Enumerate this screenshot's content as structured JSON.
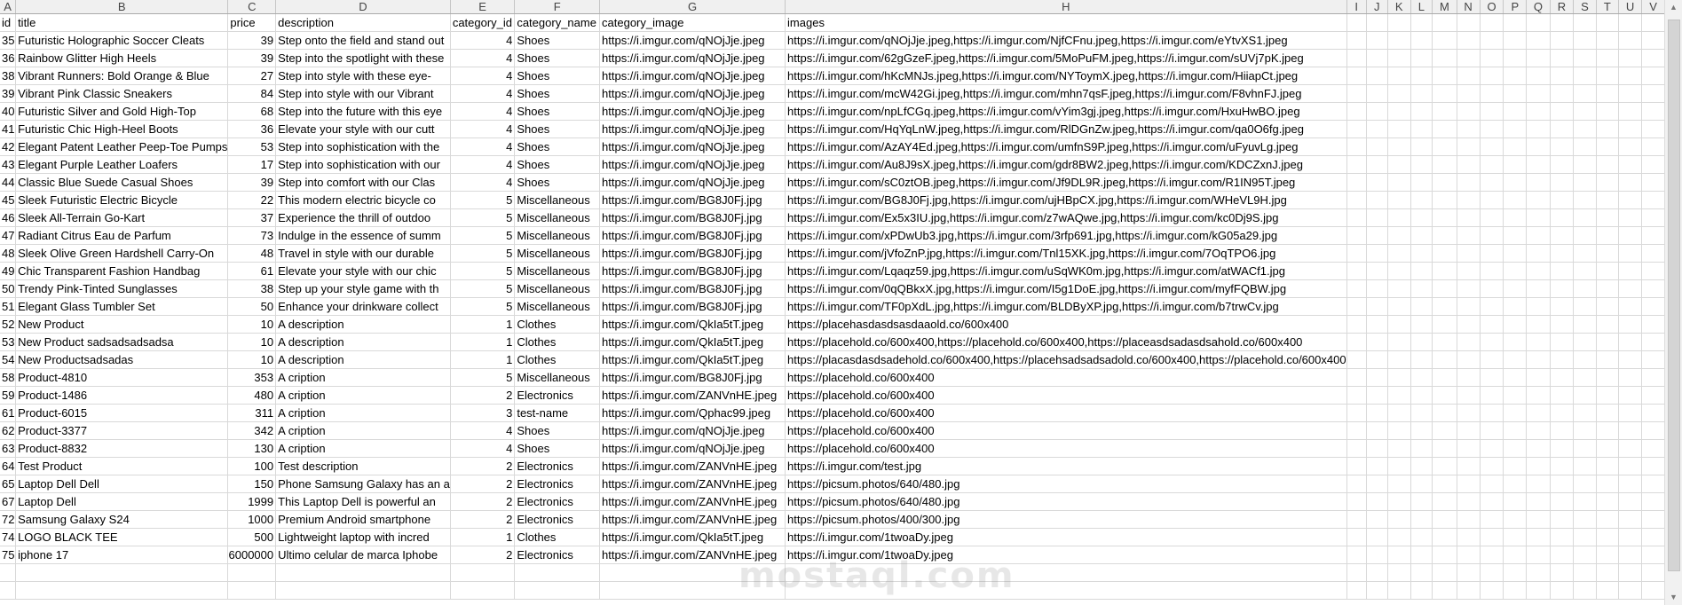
{
  "columns": [
    "A",
    "B",
    "C",
    "D",
    "E",
    "F",
    "G",
    "H",
    "I",
    "J",
    "K",
    "L",
    "M",
    "N",
    "O",
    "P",
    "Q",
    "R",
    "S",
    "T",
    "U",
    "V"
  ],
  "header_row": [
    "id",
    "title",
    "price",
    "description",
    "category_id",
    "category_name",
    "category_image",
    "images"
  ],
  "rows": [
    [
      "35",
      "Futuristic Holographic Soccer Cleats",
      "39",
      "Step onto the field and stand out",
      "4",
      "Shoes",
      "https://i.imgur.com/qNOjJje.jpeg",
      "https://i.imgur.com/qNOjJje.jpeg,https://i.imgur.com/NjfCFnu.jpeg,https://i.imgur.com/eYtvXS1.jpeg"
    ],
    [
      "36",
      "Rainbow Glitter High Heels",
      "39",
      "Step into the spotlight with these",
      "4",
      "Shoes",
      "https://i.imgur.com/qNOjJje.jpeg",
      "https://i.imgur.com/62gGzeF.jpeg,https://i.imgur.com/5MoPuFM.jpeg,https://i.imgur.com/sUVj7pK.jpeg"
    ],
    [
      "38",
      "Vibrant Runners: Bold Orange & Blue",
      "27",
      "Step into style with these eye-",
      "4",
      "Shoes",
      "https://i.imgur.com/qNOjJje.jpeg",
      "https://i.imgur.com/hKcMNJs.jpeg,https://i.imgur.com/NYToymX.jpeg,https://i.imgur.com/HiiapCt.jpeg"
    ],
    [
      "39",
      "Vibrant Pink Classic Sneakers",
      "84",
      "Step into style with our Vibrant",
      "4",
      "Shoes",
      "https://i.imgur.com/qNOjJje.jpeg",
      "https://i.imgur.com/mcW42Gi.jpeg,https://i.imgur.com/mhn7qsF.jpeg,https://i.imgur.com/F8vhnFJ.jpeg"
    ],
    [
      "40",
      "Futuristic Silver and Gold High-Top",
      "68",
      "Step into the future with this eye",
      "4",
      "Shoes",
      "https://i.imgur.com/qNOjJje.jpeg",
      "https://i.imgur.com/npLfCGq.jpeg,https://i.imgur.com/vYim3gj.jpeg,https://i.imgur.com/HxuHwBO.jpeg"
    ],
    [
      "41",
      "Futuristic Chic High-Heel Boots",
      "36",
      "Elevate your style with our cutt",
      "4",
      "Shoes",
      "https://i.imgur.com/qNOjJje.jpeg",
      "https://i.imgur.com/HqYqLnW.jpeg,https://i.imgur.com/RlDGnZw.jpeg,https://i.imgur.com/qa0O6fg.jpeg"
    ],
    [
      "42",
      "Elegant Patent Leather Peep-Toe Pumps",
      "53",
      "Step into sophistication with the",
      "4",
      "Shoes",
      "https://i.imgur.com/qNOjJje.jpeg",
      "https://i.imgur.com/AzAY4Ed.jpeg,https://i.imgur.com/umfnS9P.jpeg,https://i.imgur.com/uFyuvLg.jpeg"
    ],
    [
      "43",
      "Elegant Purple Leather Loafers",
      "17",
      "Step into sophistication with our",
      "4",
      "Shoes",
      "https://i.imgur.com/qNOjJje.jpeg",
      "https://i.imgur.com/Au8J9sX.jpeg,https://i.imgur.com/gdr8BW2.jpeg,https://i.imgur.com/KDCZxnJ.jpeg"
    ],
    [
      "44",
      "Classic Blue Suede Casual Shoes",
      "39",
      "Step into comfort with our Clas",
      "4",
      "Shoes",
      "https://i.imgur.com/qNOjJje.jpeg",
      "https://i.imgur.com/sC0ztOB.jpeg,https://i.imgur.com/Jf9DL9R.jpeg,https://i.imgur.com/R1IN95T.jpeg"
    ],
    [
      "45",
      "Sleek Futuristic Electric Bicycle",
      "22",
      "This modern electric bicycle co",
      "5",
      "Miscellaneous",
      "https://i.imgur.com/BG8J0Fj.jpg",
      "https://i.imgur.com/BG8J0Fj.jpg,https://i.imgur.com/ujHBpCX.jpg,https://i.imgur.com/WHeVL9H.jpg"
    ],
    [
      "46",
      "Sleek All-Terrain Go-Kart",
      "37",
      "Experience the thrill of outdoo",
      "5",
      "Miscellaneous",
      "https://i.imgur.com/BG8J0Fj.jpg",
      "https://i.imgur.com/Ex5x3IU.jpg,https://i.imgur.com/z7wAQwe.jpg,https://i.imgur.com/kc0Dj9S.jpg"
    ],
    [
      "47",
      "Radiant Citrus Eau de Parfum",
      "73",
      "Indulge in the essence of summ",
      "5",
      "Miscellaneous",
      "https://i.imgur.com/BG8J0Fj.jpg",
      "https://i.imgur.com/xPDwUb3.jpg,https://i.imgur.com/3rfp691.jpg,https://i.imgur.com/kG05a29.jpg"
    ],
    [
      "48",
      "Sleek Olive Green Hardshell Carry-On",
      "48",
      "Travel in style with our durable",
      "5",
      "Miscellaneous",
      "https://i.imgur.com/BG8J0Fj.jpg",
      "https://i.imgur.com/jVfoZnP.jpg,https://i.imgur.com/Tnl15XK.jpg,https://i.imgur.com/7OqTPO6.jpg"
    ],
    [
      "49",
      "Chic Transparent Fashion Handbag",
      "61",
      "Elevate your style with our chic",
      "5",
      "Miscellaneous",
      "https://i.imgur.com/BG8J0Fj.jpg",
      "https://i.imgur.com/Lqaqz59.jpg,https://i.imgur.com/uSqWK0m.jpg,https://i.imgur.com/atWACf1.jpg"
    ],
    [
      "50",
      "Trendy Pink-Tinted Sunglasses",
      "38",
      "Step up your style game with th",
      "5",
      "Miscellaneous",
      "https://i.imgur.com/BG8J0Fj.jpg",
      "https://i.imgur.com/0qQBkxX.jpg,https://i.imgur.com/I5g1DoE.jpg,https://i.imgur.com/myfFQBW.jpg"
    ],
    [
      "51",
      "Elegant Glass Tumbler Set",
      "50",
      "Enhance your drinkware collect",
      "5",
      "Miscellaneous",
      "https://i.imgur.com/BG8J0Fj.jpg",
      "https://i.imgur.com/TF0pXdL.jpg,https://i.imgur.com/BLDByXP.jpg,https://i.imgur.com/b7trwCv.jpg"
    ],
    [
      "52",
      "New Product",
      "10",
      "A description",
      "1",
      "Clothes",
      "https://i.imgur.com/QkIa5tT.jpeg",
      "https://placehasdasdsasdaaold.co/600x400"
    ],
    [
      "53",
      "New Product sadsadsadsadsa",
      "10",
      "A description",
      "1",
      "Clothes",
      "https://i.imgur.com/QkIa5tT.jpeg",
      "https://placehold.co/600x400,https://placehold.co/600x400,https://placeasdsadasdsahold.co/600x400"
    ],
    [
      "54",
      "New Productsadsadas",
      "10",
      "A description",
      "1",
      "Clothes",
      "https://i.imgur.com/QkIa5tT.jpeg",
      "https://placasdasdsadehold.co/600x400,https://placehsadsadsadold.co/600x400,https://placehold.co/600x400"
    ],
    [
      "58",
      "Product-4810",
      "353",
      "A cription",
      "5",
      "Miscellaneous",
      "https://i.imgur.com/BG8J0Fj.jpg",
      "https://placehold.co/600x400"
    ],
    [
      "59",
      "Product-1486",
      "480",
      "A cription",
      "2",
      "Electronics",
      "https://i.imgur.com/ZANVnHE.jpeg",
      "https://placehold.co/600x400"
    ],
    [
      "61",
      "Product-6015",
      "311",
      "A cription",
      "3",
      "test-name",
      "https://i.imgur.com/Qphac99.jpeg",
      "https://placehold.co/600x400"
    ],
    [
      "62",
      "Product-3377",
      "342",
      "A cription",
      "4",
      "Shoes",
      "https://i.imgur.com/qNOjJje.jpeg",
      "https://placehold.co/600x400"
    ],
    [
      "63",
      "Product-8832",
      "130",
      "A cription",
      "4",
      "Shoes",
      "https://i.imgur.com/qNOjJje.jpeg",
      "https://placehold.co/600x400"
    ],
    [
      "64",
      "Test Product",
      "100",
      "Test description",
      "2",
      "Electronics",
      "https://i.imgur.com/ZANVnHE.jpeg",
      "https://i.imgur.com/test.jpg"
    ],
    [
      "65",
      "Laptop Dell Dell",
      "150",
      "Phone Samsung Galaxy has an a",
      "2",
      "Electronics",
      "https://i.imgur.com/ZANVnHE.jpeg",
      "https://picsum.photos/640/480.jpg"
    ],
    [
      "67",
      "Laptop Dell",
      "1999",
      "This Laptop Dell is powerful an",
      "2",
      "Electronics",
      "https://i.imgur.com/ZANVnHE.jpeg",
      "https://picsum.photos/640/480.jpg"
    ],
    [
      "72",
      "Samsung Galaxy S24",
      "1000",
      "Premium Android smartphone",
      "2",
      "Electronics",
      "https://i.imgur.com/ZANVnHE.jpeg",
      "https://picsum.photos/400/300.jpg"
    ],
    [
      "74",
      " LOGO BLACK TEE",
      "500",
      "Lightweight laptop with incred",
      "1",
      "Clothes",
      "https://i.imgur.com/QkIa5tT.jpeg",
      "https://i.imgur.com/1twoaDy.jpeg"
    ],
    [
      "75",
      "iphone 17",
      "6000000",
      "Ultimo celular de marca Iphobe",
      "2",
      "Electronics",
      "https://i.imgur.com/ZANVnHE.jpeg",
      "https://i.imgur.com/1twoaDy.jpeg"
    ]
  ],
  "watermark": "mostaql.com"
}
